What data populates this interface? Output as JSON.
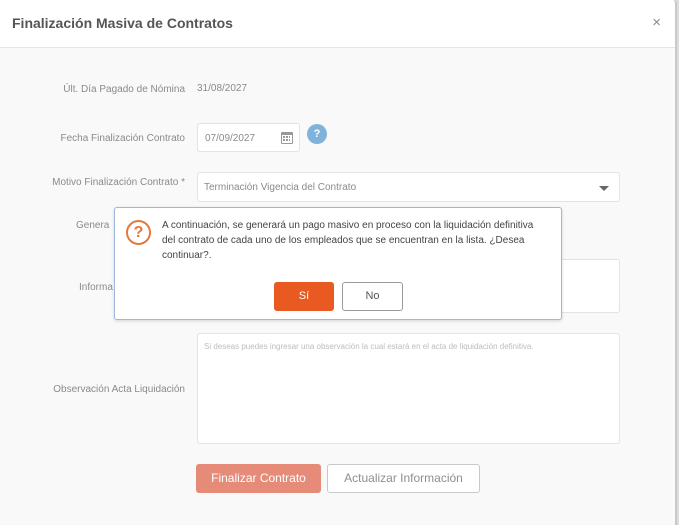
{
  "modal": {
    "title": "Finalización Masiva de Contratos",
    "close_label": "×"
  },
  "form": {
    "last_paid_day": {
      "label": "Últ. Día Pagado de Nómina",
      "value": "31/08/2027"
    },
    "end_date": {
      "label": "Fecha Finalización Contrato",
      "value": "07/09/2027",
      "help_icon": "?"
    },
    "reason": {
      "label": "Motivo Finalización Contrato *",
      "value": "Terminación Vigencia del Contrato"
    },
    "generate": {
      "label_partial": "Genera"
    },
    "information": {
      "label_partial": "Informa"
    },
    "observation": {
      "label": "Observación Acta Liquidación",
      "placeholder": "Si deseas puedes ingresar una observación la cual estará en el acta de liquidación definitiva."
    }
  },
  "buttons": {
    "finalize": "Finalizar Contrato",
    "update": "Actualizar Información"
  },
  "dialog": {
    "icon": "?",
    "message": "A continuación, se generará un pago masivo en proceso con la liquidación definitiva del contrato de cada uno de los empleados que se encuentran en la lista. ¿Desea continuar?.",
    "yes_label": "Sí",
    "no_label": "No"
  },
  "colors": {
    "primary_button": "#e58b78",
    "dialog_yes": "#e85a22",
    "question_icon": "#e8783a",
    "help_icon": "#7fb3db"
  }
}
